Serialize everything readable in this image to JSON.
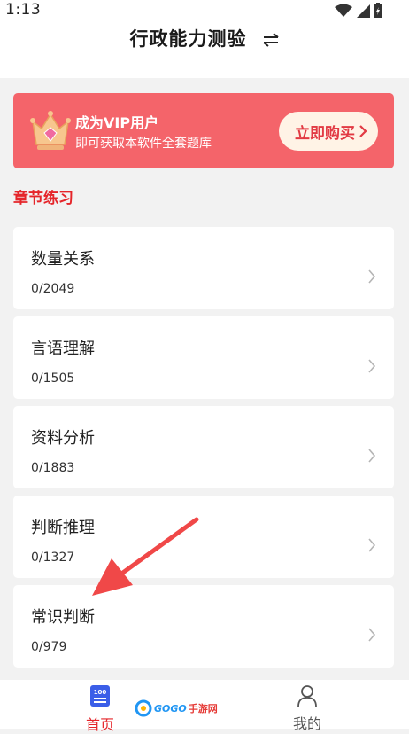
{
  "status_bar": {
    "time": "1:13",
    "icons": [
      "wifi-icon",
      "signal-icon",
      "battery-icon"
    ]
  },
  "header": {
    "title": "行政能力测验",
    "swap_icon": "swap-icon"
  },
  "vip_banner": {
    "title": "成为VIP用户",
    "subtitle": "即可获取本软件全套题库",
    "button_label": "立即购买",
    "bg_color": "#f4646a",
    "button_text_color": "#e23a43"
  },
  "section": {
    "title": "章节练习",
    "color": "#e5252a"
  },
  "chapters": [
    {
      "title": "数量关系",
      "progress": "0/2049"
    },
    {
      "title": "言语理解",
      "progress": "0/1505"
    },
    {
      "title": "资料分析",
      "progress": "0/1883"
    },
    {
      "title": "判断推理",
      "progress": "0/1327"
    },
    {
      "title": "常识判断",
      "progress": "0/979"
    }
  ],
  "bottom_nav": {
    "home_label": "首页",
    "mine_label": "我的",
    "home_icon_text": "100",
    "active_color": "#e5252a"
  },
  "watermark": {
    "text_a": "GOGO",
    "text_b": "手游网"
  }
}
